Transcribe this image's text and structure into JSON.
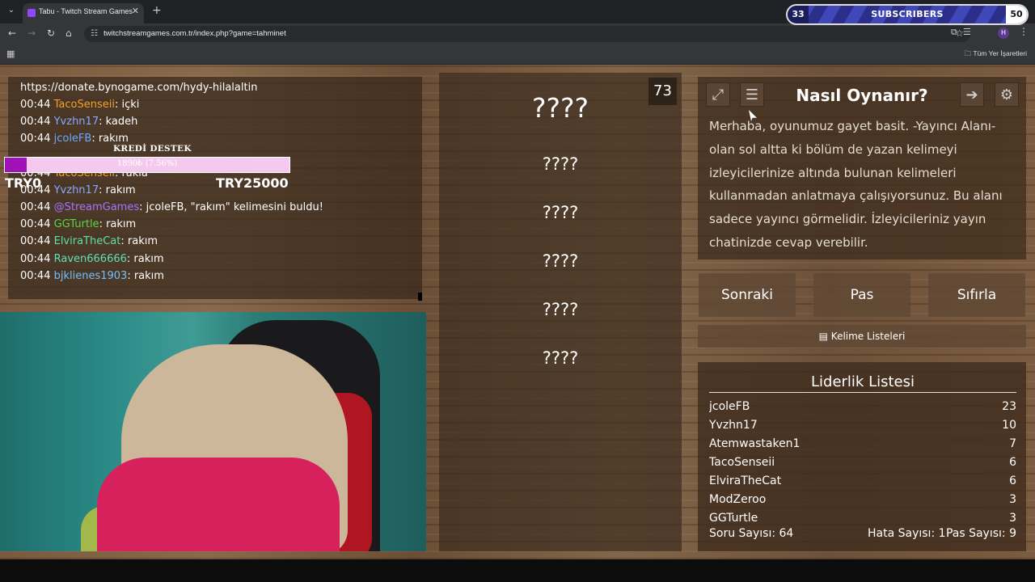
{
  "browser": {
    "tab_title": "Tabu - Twitch Stream Games",
    "url": "twitchstreamgames.com.tr/index.php?game=tahminet",
    "bookmarks_label": "Tüm Yer İşaretleri",
    "profile_initial": "H"
  },
  "subscriber_widget": {
    "left_count": "33",
    "label": "SUBSCRIBERS",
    "right_count": "50"
  },
  "chat": {
    "donate_url": "https://donate.bynogame.com/hydy-hilalaltin",
    "lines": [
      {
        "time": "00:44",
        "user": "TacoSenseii",
        "color": "#f2a02c",
        "message": ": içki"
      },
      {
        "time": "00:44",
        "user": "Yvzhn17",
        "color": "#8aa8ff",
        "message": ": kadeh"
      },
      {
        "time": "00:44",
        "user": "jcoleFB",
        "color": "#6aa8ff",
        "message": ": rakım"
      },
      {
        "time": "00:44",
        "user": "TacoSenseii",
        "color": "#f2a02c",
        "message": ": rakla"
      },
      {
        "time": "00:44",
        "user": "Yvzhn17",
        "color": "#8aa8ff",
        "message": ": rakım"
      },
      {
        "time": "00:44",
        "user": "@StreamGames",
        "color": "#a970ff",
        "message": ": jcoleFB, \"rakım\" kelimesini buldu!"
      },
      {
        "time": "00:44",
        "user": "GGTurtle",
        "color": "#59d646",
        "message": ": rakım"
      },
      {
        "time": "00:44",
        "user": "ElviraTheCat",
        "color": "#5fe0a3",
        "message": ": rakım"
      },
      {
        "time": "00:44",
        "user": "Raven666666",
        "color": "#5fe0b8",
        "message": ": rakım"
      },
      {
        "time": "00:44",
        "user": "bjklienes1903",
        "color": "#6ec0ff",
        "message": ": rakım"
      }
    ]
  },
  "credit": {
    "title": "KREDİ DESTEK",
    "amount_text": "1890₺ (7.56%)",
    "progress_fraction": 0.0756,
    "min_label": "TRY0",
    "max_label": "TRY25000"
  },
  "game": {
    "timer": "73",
    "words": [
      "????",
      "????",
      "????",
      "????",
      "????",
      "????"
    ]
  },
  "howto": {
    "title": "Nasıl Oynanır?",
    "text": "Merhaba, oyunumuz gayet basit. -Yayıncı Alanı- olan sol altta ki bölüm de yazan kelimeyi izleyicilerinize altında bulunan kelimeleri kullanmadan anlatmaya çalışıyorsunuz. Bu alanı sadece yayıncı görmelidir. İzleyicileriniz yayın chatinizde cevap verebilir.",
    "icons": [
      "fullscreen-icon",
      "document-icon",
      "exit-icon",
      "gear-icon"
    ]
  },
  "controls": {
    "next": "Sonraki",
    "pass": "Pas",
    "reset": "Sıfırla",
    "word_lists": "Kelime Listeleri"
  },
  "leaderboard": {
    "title": "Liderlik Listesi",
    "rows": [
      {
        "name": "jcoleFB",
        "score": "23"
      },
      {
        "name": "Yvzhn17",
        "score": "10"
      },
      {
        "name": "Atemwastaken1",
        "score": "7"
      },
      {
        "name": "TacoSenseii",
        "score": "6"
      },
      {
        "name": "ElviraTheCat",
        "score": "6"
      },
      {
        "name": "ModZeroo",
        "score": "3"
      },
      {
        "name": "GGTurtle",
        "score": "3"
      }
    ],
    "stats": {
      "questions": "Soru Sayısı: 64",
      "errors": "Hata Sayısı: 1",
      "passes": "Pas Sayısı: 9"
    }
  }
}
